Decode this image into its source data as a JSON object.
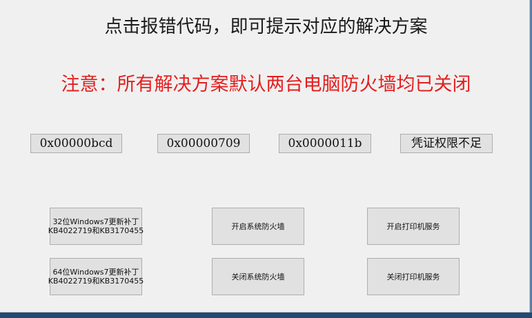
{
  "title": "点击报错代码，即可提示对应的解决方案",
  "warning": "注意：所有解决方案默认两台电脑防火墙均已关闭",
  "warning_color": "#e41e1e",
  "codes": [
    {
      "label": "0x00000bcd"
    },
    {
      "label": "0x00000709"
    },
    {
      "label": "0x0000011b"
    },
    {
      "label": "凭证权限不足"
    }
  ],
  "actions": {
    "win7_32": {
      "line1": "32位Windows7更新补丁",
      "line2": "KB4022719和KB3170455"
    },
    "win7_64": {
      "line1": "64位Windows7更新补丁",
      "line2": "KB4022719和KB3170455"
    },
    "enable_firewall": "开启系统防火墙",
    "disable_firewall": "关闭系统防火墙",
    "enable_print": "开启打印机服务",
    "disable_print": "关闭打印机服务"
  }
}
